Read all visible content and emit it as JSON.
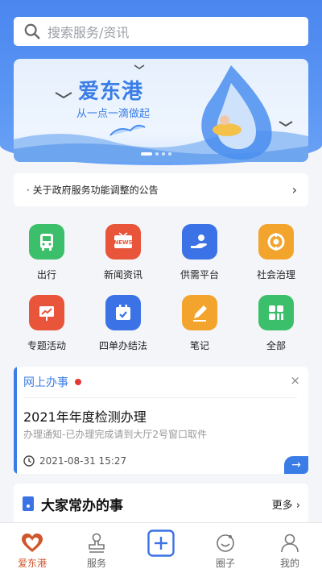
{
  "search": {
    "placeholder": "搜索服务/资讯"
  },
  "banner": {
    "title": "爱东港",
    "subtitle": "从一点一滴做起"
  },
  "notice": {
    "text": "· 关于政府服务功能调整的公告",
    "chevron": "›"
  },
  "services": [
    {
      "label": "出行",
      "icon": "bus-icon",
      "color": "#3cbf6a"
    },
    {
      "label": "新闻资讯",
      "icon": "news-icon",
      "color": "#e8553a"
    },
    {
      "label": "供需平台",
      "icon": "hand-icon",
      "color": "#3b72e6"
    },
    {
      "label": "社会治理",
      "icon": "target-icon",
      "color": "#f2a42c"
    },
    {
      "label": "专题活动",
      "icon": "chart-icon",
      "color": "#e8553a"
    },
    {
      "label": "四单办结法",
      "icon": "calendar-icon",
      "color": "#3b72e6"
    },
    {
      "label": "笔记",
      "icon": "pencil-icon",
      "color": "#f2a42c"
    },
    {
      "label": "全部",
      "icon": "grid-icon",
      "color": "#3cbf6a"
    }
  ],
  "task_card": {
    "header": "网上办事",
    "title": "2021年年度检测办理",
    "subtitle": "办理通知-已办理完成请到大厅2号窗口取件",
    "time": "2021-08-31 15:27",
    "close": "×"
  },
  "section": {
    "title": "大家常办的事",
    "more": "更多 ›"
  },
  "tabs": [
    {
      "label": "爱东港",
      "icon": "heart-icon",
      "active": true
    },
    {
      "label": "服务",
      "icon": "stamp-icon",
      "active": false
    },
    {
      "label": "",
      "icon": "plus-icon",
      "active": false
    },
    {
      "label": "圈子",
      "icon": "circle-icon",
      "active": false
    },
    {
      "label": "我的",
      "icon": "user-icon",
      "active": false
    }
  ],
  "colors": {
    "primary": "#3a7de6",
    "accent": "#d0562c"
  }
}
